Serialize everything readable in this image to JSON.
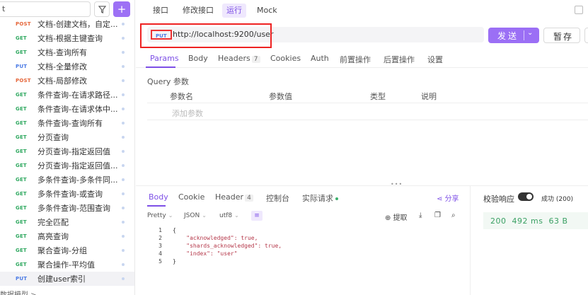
{
  "sidebar": {
    "search_text": "t",
    "filter_icon": "filter-icon",
    "add_icon": "plus-icon",
    "items": [
      {
        "method": "POST",
        "name": "文档-创建文档，自定...",
        "color": "#e5663a"
      },
      {
        "method": "GET",
        "name": "文档-根据主键查询",
        "color": "#2ea85f"
      },
      {
        "method": "GET",
        "name": "文档-查询所有",
        "color": "#2ea85f"
      },
      {
        "method": "PUT",
        "name": "文档-全量修改",
        "color": "#4b7be5"
      },
      {
        "method": "POST",
        "name": "文档-局部修改",
        "color": "#e5663a"
      },
      {
        "method": "GET",
        "name": "条件查询-在请求路径...",
        "color": "#2ea85f"
      },
      {
        "method": "GET",
        "name": "条件查询-在请求体中...",
        "color": "#2ea85f"
      },
      {
        "method": "GET",
        "name": "条件查询-查询所有",
        "color": "#2ea85f"
      },
      {
        "method": "GET",
        "name": "分页查询",
        "color": "#2ea85f"
      },
      {
        "method": "GET",
        "name": "分页查询-指定返回值",
        "color": "#2ea85f"
      },
      {
        "method": "GET",
        "name": "分页查询-指定返回值...",
        "color": "#2ea85f"
      },
      {
        "method": "GET",
        "name": "多条件查询-多条件同...",
        "color": "#2ea85f"
      },
      {
        "method": "GET",
        "name": "多条件查询-或查询",
        "color": "#2ea85f"
      },
      {
        "method": "GET",
        "name": "多条件查询-范围查询",
        "color": "#2ea85f"
      },
      {
        "method": "GET",
        "name": "完全匹配",
        "color": "#2ea85f"
      },
      {
        "method": "GET",
        "name": "高亮查询",
        "color": "#2ea85f"
      },
      {
        "method": "GET",
        "name": "聚合查询-分组",
        "color": "#2ea85f"
      },
      {
        "method": "GET",
        "name": "聚合操作-平均值",
        "color": "#2ea85f"
      },
      {
        "method": "PUT",
        "name": "创建user索引",
        "color": "#4b7be5",
        "active": true
      }
    ],
    "footer": "数据模型 >"
  },
  "top_tabs": [
    {
      "label": "接口",
      "active": false
    },
    {
      "label": "修改接口",
      "active": false
    },
    {
      "label": "运行",
      "active": true
    },
    {
      "label": "Mock",
      "active": false
    }
  ],
  "request": {
    "method": "PUT",
    "url": "http://localhost:9200/user",
    "send_label": "发送",
    "save_label": "暂存"
  },
  "req_tabs": [
    {
      "label": "Params",
      "active": true
    },
    {
      "label": "Body"
    },
    {
      "label": "Headers",
      "count": "7"
    },
    {
      "label": "Cookies"
    },
    {
      "label": "Auth"
    },
    {
      "label": "前置操作"
    },
    {
      "label": "后置操作"
    },
    {
      "label": "设置"
    }
  ],
  "query": {
    "title": "Query 参数",
    "columns": [
      "参数名",
      "参数值",
      "类型",
      "说明"
    ],
    "placeholder": "添加参数"
  },
  "response": {
    "tabs": [
      {
        "label": "Body",
        "active": true
      },
      {
        "label": "Cookie"
      },
      {
        "label": "Header",
        "count": "4"
      },
      {
        "label": "控制台"
      },
      {
        "label": "实际请求"
      }
    ],
    "share": "分享",
    "toolbar": {
      "format": "Pretty",
      "lang": "JSON",
      "encoding": "utf8",
      "extract": "提取"
    },
    "code_lines": [
      "{",
      "    \"acknowledged\": true,",
      "    \"shards_acknowledged\": true,",
      "    \"index\": \"user\"",
      "}"
    ],
    "validate_label": "校验响应",
    "success_label": "成功 (200)",
    "status": {
      "code": "200",
      "time": "492 ms",
      "size": "63 B"
    }
  }
}
